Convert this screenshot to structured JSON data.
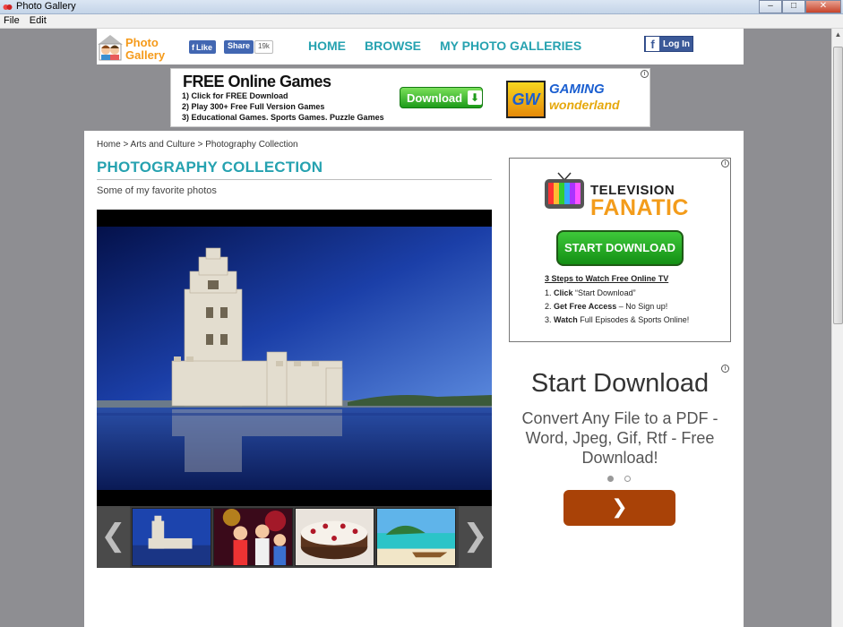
{
  "window": {
    "title": "Photo Gallery",
    "controls": [
      "minimize",
      "maximize",
      "close"
    ]
  },
  "menu": {
    "items": [
      "File",
      "Edit"
    ]
  },
  "header": {
    "logo": {
      "line1": "Photo",
      "line2": "Gallery"
    },
    "facebook": {
      "like_label": "Like",
      "share_label": "Share",
      "count": "19k",
      "login_label": "Log In"
    },
    "nav": [
      "HOME",
      "BROWSE",
      "MY PHOTO GALLERIES"
    ]
  },
  "ad_top": {
    "title": "FREE Online Games",
    "lines": [
      "1) Click for FREE Download",
      "2) Play 300+ Free Full Version Games",
      "3) Educational Games. Sports Games. Puzzle Games"
    ],
    "button_label": "Download",
    "brand_mark": "GW",
    "brand_line1": "GAMING",
    "brand_line2": "wonderland"
  },
  "breadcrumb": [
    "Home",
    "Arts and Culture",
    "Photography Collection"
  ],
  "breadcrumb_separator": ">",
  "page": {
    "title": "PHOTOGRAPHY COLLECTION",
    "subtitle": "Some of my favorite photos"
  },
  "gallery": {
    "thumbnails": [
      "tower-photo",
      "party-photo",
      "cake-photo",
      "beach-photo"
    ],
    "prev_icon": "chevron-left-icon",
    "next_icon": "chevron-right-icon"
  },
  "ad_tv": {
    "brand_line1": "TELEVISION",
    "brand_line2": "FANATIC",
    "button_label": "START DOWNLOAD",
    "steps_title": "3 Steps to Watch Free Online TV",
    "steps": [
      {
        "num": "1.",
        "bold": "Click",
        "rest": " “Start Download”"
      },
      {
        "num": "2.",
        "bold": "Get Free Access",
        "rest": " – No Sign up!"
      },
      {
        "num": "3.",
        "bold": "Watch",
        "rest": " Full Episodes & Sports Online!"
      }
    ]
  },
  "ad_pdf": {
    "title": "Start Download",
    "text": "Convert Any File to a PDF - Word, Jpeg, Gif, Rtf - Free Download!",
    "button_icon": "chevron-right-icon"
  },
  "colors": {
    "accent": "#26a2b0",
    "logo": "#f59a1a",
    "facebook": "#3b5998",
    "pdf_button": "#a94207"
  }
}
